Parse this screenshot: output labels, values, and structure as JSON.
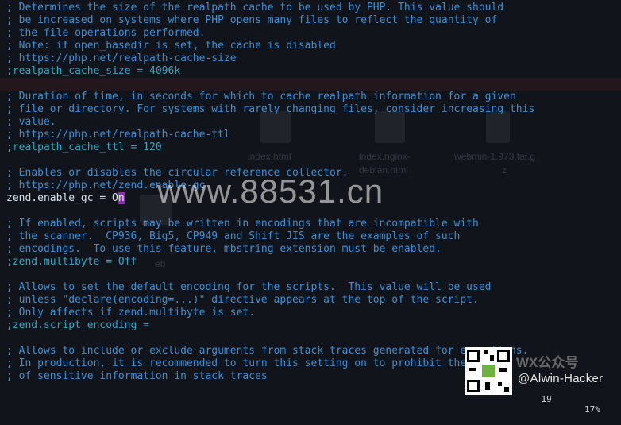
{
  "editor": {
    "lines": [
      "; Determines the size of the realpath cache to be used by PHP. This value should",
      "; be increased on systems where PHP opens many files to reflect the quantity of",
      "; the file operations performed.",
      "; Note: if open_basedir is set, the cache is disabled",
      "; https://php.net/realpath-cache-size",
      ";realpath_cache_size = 4096k",
      "",
      "; Duration of time, in seconds for which to cache realpath information for a given",
      "; file or directory. For systems with rarely changing files, consider increasing this",
      "; value.",
      "; https://php.net/realpath-cache-ttl",
      ";realpath_cache_ttl = 120",
      "",
      "; Enables or disables the circular reference collector.",
      "; https://php.net/zend.enable-gc",
      "zend.enable_gc = O",
      "",
      "; If enabled, scripts may be written in encodings that are incompatible with",
      "; the scanner.  CP936, Big5, CP949 and Shift_JIS are the examples of such",
      "; encodings.  To use this feature, mbstring extension must be enabled.",
      ";zend.multibyte = Off",
      "",
      "; Allows to set the default encoding for the scripts.  This value will be used",
      "; unless \"declare(encoding=...)\" directive appears at the top of the script.",
      "; Only affects if zend.multibyte is set.",
      ";zend.script_encoding =",
      "",
      "; Allows to include or exclude arguments from stack traces generated for exceptions.",
      "; In production, it is recommended to turn this setting on to prohibit the output",
      "; of sensitive information in stack traces"
    ],
    "cursor_char": "n",
    "status_position": "19",
    "status_percent": "17%"
  },
  "overlay": {
    "watermark": "www.88531.cn",
    "wechat_label": "WX公众号",
    "author": "@Alwin-Hacker",
    "desktop_ghosts": [
      "index.html",
      "index.nginx-",
      "debian.html",
      "webmin-1.973.tar.g",
      "z",
      "eb"
    ]
  }
}
